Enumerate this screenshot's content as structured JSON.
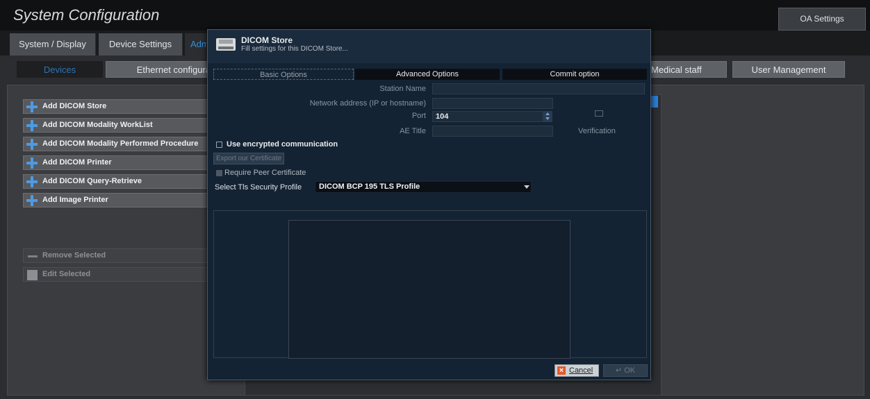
{
  "window": {
    "title": "System Configuration",
    "oa_settings_label": "OA Settings"
  },
  "top_tabs": [
    {
      "label": "System / Display"
    },
    {
      "label": "Device Settings"
    },
    {
      "label": "Adm"
    }
  ],
  "sub_tabs": [
    {
      "label": "Devices"
    },
    {
      "label": "Ethernet configura"
    },
    {
      "label": "Medical staff"
    },
    {
      "label": "User Management"
    }
  ],
  "actions": {
    "items": [
      {
        "label": "Add DICOM Store"
      },
      {
        "label": "Add DICOM Modality WorkList"
      },
      {
        "label": "Add DICOM Modality Performed Procedure"
      },
      {
        "label": "Add DICOM Printer"
      },
      {
        "label": "Add DICOM Query-Retrieve"
      },
      {
        "label": "Add Image Printer"
      }
    ],
    "remove_selected": "Remove Selected",
    "edit_selected": "Edit Selected"
  },
  "dialog": {
    "title": "DICOM Store",
    "subtitle": "Fill settings for this DICOM Store...",
    "tabs": [
      {
        "label": "Basic Options"
      },
      {
        "label": "Advanced Options"
      },
      {
        "label": "Commit option"
      }
    ],
    "fields": {
      "station_name_label": "Station Name",
      "station_name_value": "",
      "network_address_label": "Network address (IP or hostname)",
      "network_address_value": "",
      "port_label": "Port",
      "port_value": "104",
      "ae_title_label": "AE Title",
      "ae_title_value": ""
    },
    "verification_label": "Verification",
    "use_encrypted_label": "Use encrypted communication",
    "export_certificate_label": "Export our Certificate",
    "require_peer_certificate_label": "Require Peer Certificate",
    "tls_profile_label": "Select Tls Security Profile",
    "tls_profile_value": "DICOM BCP 195 TLS Profile",
    "cancel_label": "Cancel",
    "ok_label": "OK"
  },
  "colors": {
    "accent_blue": "#3a8cd6",
    "dialog_bg": "#142333",
    "cancel_icon": "#e35a2a"
  }
}
